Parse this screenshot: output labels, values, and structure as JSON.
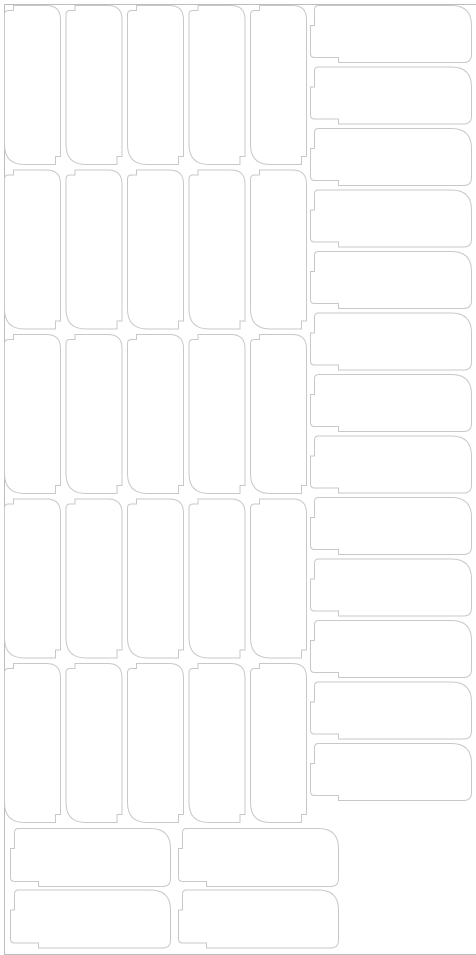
{
  "sheet": {
    "colors": {
      "background": "#ffffff",
      "outline": "#c8c8c8",
      "border": "#bdbdbd"
    },
    "portrait_grid": {
      "rows": 5,
      "columns": 5
    },
    "landscape_column": {
      "count": 13
    },
    "landscape_bottom": {
      "rows": 2,
      "columns": 2
    }
  }
}
